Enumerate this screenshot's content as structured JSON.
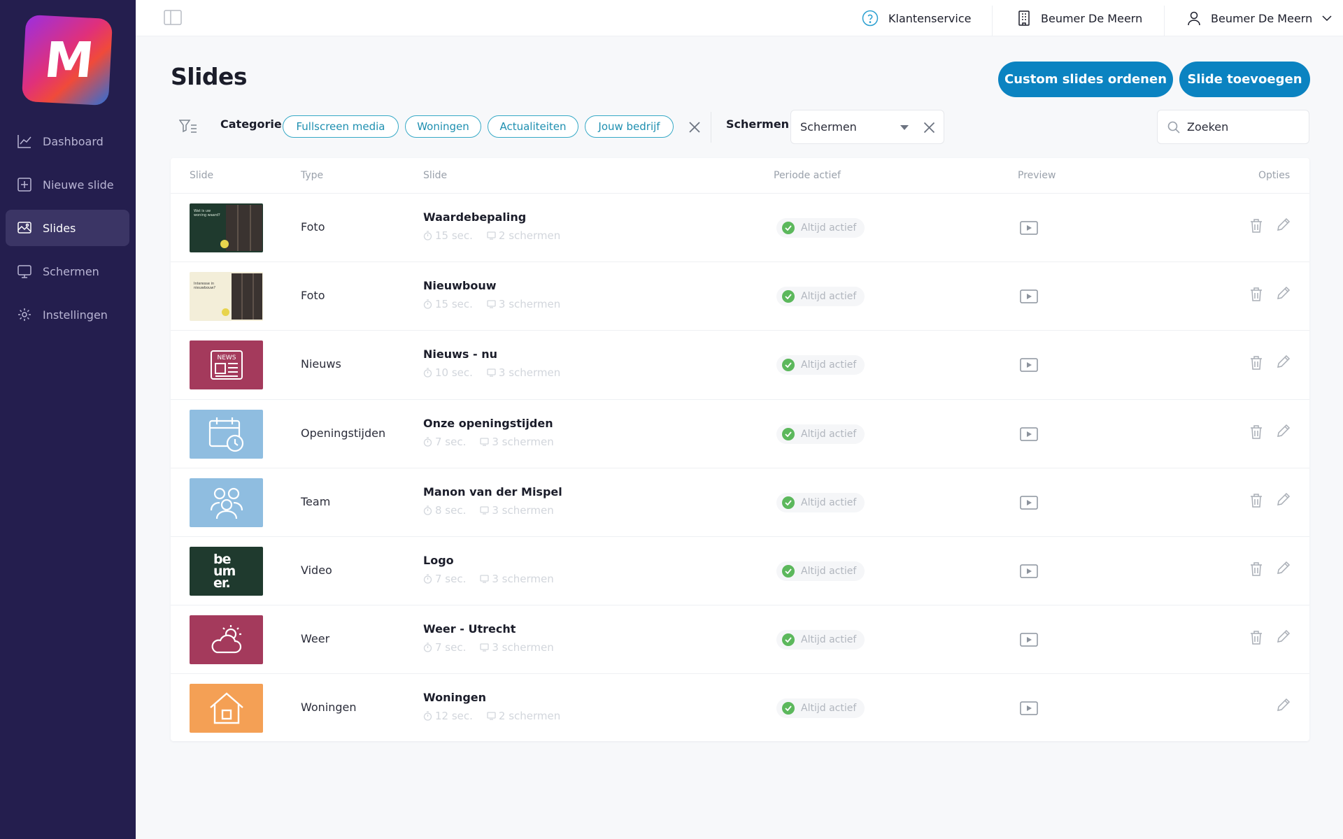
{
  "app": {
    "logo_letter": "M"
  },
  "sidebar": {
    "items": [
      {
        "label": "Dashboard",
        "icon": "chart-line-icon",
        "active": false
      },
      {
        "label": "Nieuwe slide",
        "icon": "plus-square-icon",
        "active": false
      },
      {
        "label": "Slides",
        "icon": "image-gallery-icon",
        "active": true
      },
      {
        "label": "Schermen",
        "icon": "monitor-icon",
        "active": false
      },
      {
        "label": "Instellingen",
        "icon": "gear-icon",
        "active": false
      }
    ]
  },
  "topbar": {
    "support": "Klantenservice",
    "location": "Beumer De Meern",
    "user": "Beumer De Meern"
  },
  "header": {
    "title": "Slides",
    "btn_order": "Custom slides ordenen",
    "btn_add": "Slide toevoegen"
  },
  "filters": {
    "category_label": "Categorie",
    "chips": [
      "Fullscreen media",
      "Woningen",
      "Actualiteiten",
      "Jouw bedrijf"
    ],
    "screens_label": "Schermen",
    "screens_value": "Schermen",
    "search_placeholder": "Zoeken"
  },
  "table": {
    "headers": {
      "slide_thumb": "Slide",
      "type": "Type",
      "slide": "Slide",
      "period": "Periode actief",
      "preview": "Preview",
      "options": "Opties"
    },
    "rows": [
      {
        "type": "Foto",
        "title": "Waardebepaling",
        "duration": "15 sec.",
        "screens": "2 schermen",
        "status": "Altijd actief",
        "deletable": true,
        "thumb": "photo-dark",
        "thumb_text": "Wat is uw woning waard?"
      },
      {
        "type": "Foto",
        "title": "Nieuwbouw",
        "duration": "15 sec.",
        "screens": "3 schermen",
        "status": "Altijd actief",
        "deletable": true,
        "thumb": "photo-light",
        "thumb_text": "Interesse in nieuwbouw?"
      },
      {
        "type": "Nieuws",
        "title": "Nieuws - nu",
        "duration": "10 sec.",
        "screens": "3 schermen",
        "status": "Altijd actief",
        "deletable": true,
        "thumb": "news",
        "thumb_text": "NEWS"
      },
      {
        "type": "Openingstijden",
        "title": "Onze openingstijden",
        "duration": "7 sec.",
        "screens": "3 schermen",
        "status": "Altijd actief",
        "deletable": true,
        "thumb": "calendar"
      },
      {
        "type": "Team",
        "title": "Manon van der Mispel",
        "duration": "8 sec.",
        "screens": "3 schermen",
        "status": "Altijd actief",
        "deletable": true,
        "thumb": "team"
      },
      {
        "type": "Video",
        "title": "Logo",
        "duration": "7 sec.",
        "screens": "3 schermen",
        "status": "Altijd actief",
        "deletable": true,
        "thumb": "logo",
        "thumb_lines": [
          "be",
          "um",
          "er."
        ]
      },
      {
        "type": "Weer",
        "title": "Weer - Utrecht",
        "duration": "7 sec.",
        "screens": "3 schermen",
        "status": "Altijd actief",
        "deletable": true,
        "thumb": "weather"
      },
      {
        "type": "Woningen",
        "title": "Woningen",
        "duration": "12 sec.",
        "screens": "2 schermen",
        "status": "Altijd actief",
        "deletable": false,
        "thumb": "house"
      }
    ]
  },
  "colors": {
    "sidebar_bg": "#241e4e",
    "accent": "#0b83c1",
    "chip_border": "#36a9c6",
    "status_ok": "#5cb85c",
    "thumb_red": "#a43a5c",
    "thumb_blue": "#8fbde0",
    "thumb_green": "#1f3a2e",
    "thumb_orange": "#f4a055"
  }
}
